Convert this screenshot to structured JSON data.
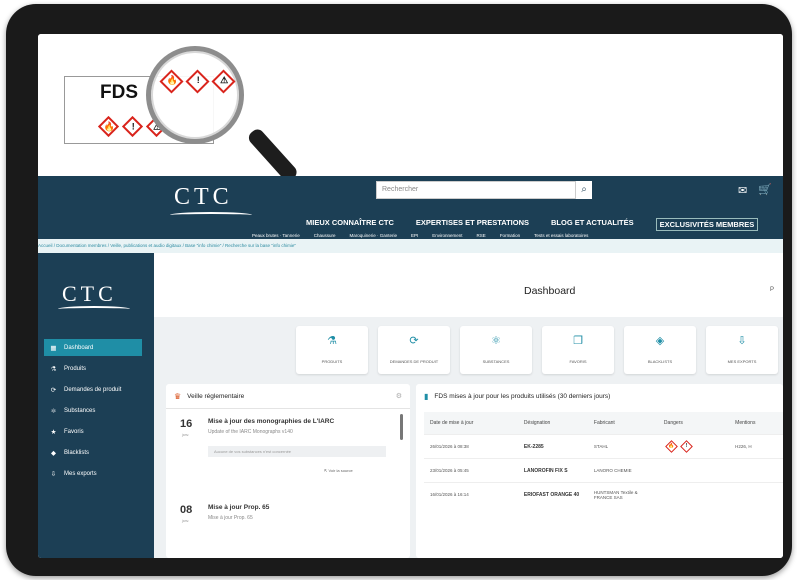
{
  "banner": {
    "label": "FDS",
    "hazard_icons": [
      "flame-icon",
      "exclamation-icon",
      "environment-icon"
    ],
    "hazard_glyphs": [
      "🔥",
      "!",
      "⚠"
    ]
  },
  "topnav": {
    "logo": "CTC",
    "search_placeholder": "Rechercher",
    "menu": [
      "MIEUX CONNAÎTRE CTC",
      "EXPERTISES ET PRESTATIONS",
      "BLOG ET ACTUALITÉS",
      "EXCLUSIVITÉS MEMBRES"
    ],
    "submenu": [
      "Peaux brutes · Tannerie",
      "Chaussure",
      "Maroquinerie · Ganterie",
      "EPI",
      "Environnement",
      "RSE",
      "Formation",
      "Tests et essais laboratoires"
    ]
  },
  "breadcrumb": "Accueil / Documentation membres / Veille, publications et audio digitaux / Base \"info chimie\" / Recherche sur la base \"info chimie\"",
  "sidebar": {
    "logo": "CTC",
    "items": [
      {
        "label": "Dashboard",
        "icon": "grid-icon",
        "glyph": "▦",
        "active": true
      },
      {
        "label": "Produits",
        "icon": "flask-icon",
        "glyph": "⚗",
        "active": false
      },
      {
        "label": "Demandes de produit",
        "icon": "request-icon",
        "glyph": "⟳",
        "active": false
      },
      {
        "label": "Substances",
        "icon": "substance-icon",
        "glyph": "⚛",
        "active": false
      },
      {
        "label": "Favoris",
        "icon": "bookmark-icon",
        "glyph": "★",
        "active": false
      },
      {
        "label": "Blacklists",
        "icon": "blacklist-icon",
        "glyph": "◆",
        "active": false
      },
      {
        "label": "Mes exports",
        "icon": "export-icon",
        "glyph": "⇩",
        "active": false
      }
    ]
  },
  "main": {
    "title": "Dashboard",
    "user": "P"
  },
  "tiles": [
    {
      "label": "PRODUITS",
      "icon": "flask-icon",
      "glyph": "⚗"
    },
    {
      "label": "DEMANDES DE PRODUIT",
      "icon": "request-icon",
      "glyph": "⟳"
    },
    {
      "label": "SUBSTANCES",
      "icon": "substance-icon",
      "glyph": "⚛"
    },
    {
      "label": "FAVORIS",
      "icon": "bookmark-icon",
      "glyph": "❐"
    },
    {
      "label": "BLACKLISTS",
      "icon": "blacklist-icon",
      "glyph": "◈"
    },
    {
      "label": "MES EXPORTS",
      "icon": "export-icon",
      "glyph": "⇩"
    }
  ],
  "veille": {
    "title": "Veille réglementaire",
    "news": [
      {
        "day": "16",
        "month": "janv.",
        "title": "Mise à jour des monographies de L'IARC",
        "subtitle": "Update of the IARC Monographs v140",
        "box": "Aucune de vos substances n'est concernée",
        "link": "Voir la source"
      },
      {
        "day": "08",
        "month": "janv.",
        "title": "Mise à jour Prop. 65",
        "subtitle": "Mise à jour Prop. 65"
      }
    ]
  },
  "fds": {
    "title": "FDS mises à jour pour les produits utilisés (30 derniers jours)",
    "columns": [
      "Date de mise à jour",
      "Désignation",
      "Fabricant",
      "Dangers",
      "Mentions"
    ],
    "rows": [
      {
        "date": "26/01/2026 à 08:38",
        "designation": "EK-2285",
        "fabricant": "STAHL",
        "mentions": "H226, H"
      },
      {
        "date": "23/01/2026 à 05:45",
        "designation": "LANOROFIN FIX S",
        "fabricant": "LANORO CHEMIE",
        "mentions": ""
      },
      {
        "date": "16/01/2026 à 16:14",
        "designation": "ERIOFAST ORANGE 40",
        "fabricant": "HUNTSMAN Textile & FRANCE SAS",
        "mentions": ""
      }
    ]
  }
}
